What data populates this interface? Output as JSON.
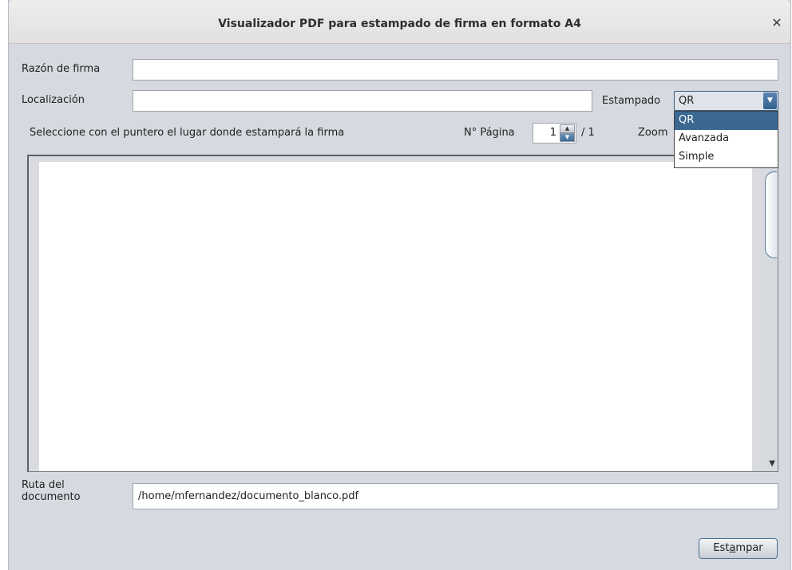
{
  "window": {
    "title": "Visualizador PDF para estampado de firma en formato A4"
  },
  "form": {
    "reason_label": "Razón de firma",
    "reason_value": "",
    "location_label": "Localización",
    "location_value": "",
    "stamp_label": "Estampado",
    "stamp_selected": "QR",
    "stamp_options": [
      "QR",
      "Avanzada",
      "Simple"
    ],
    "instruction": "Seleccione con el puntero el lugar donde estampará la firma",
    "page_label": "N° Página",
    "page_value": "1",
    "page_total": "/ 1",
    "zoom_label": "Zoom",
    "path_label_line1": "Ruta del",
    "path_label_line2": "documento",
    "path_value": "/home/mfernandez/documento_blanco.pdf"
  },
  "actions": {
    "stamp_button_pre": "Est",
    "stamp_button_mnemonic": "a",
    "stamp_button_post": "mpar"
  },
  "colors": {
    "selection": "#3a6890",
    "window_bg": "#d6d9df"
  },
  "icons": {
    "close": "close-icon",
    "combo": "chevron-down-icon",
    "spin_up": "arrow-up-icon",
    "spin_down": "arrow-down-icon"
  }
}
